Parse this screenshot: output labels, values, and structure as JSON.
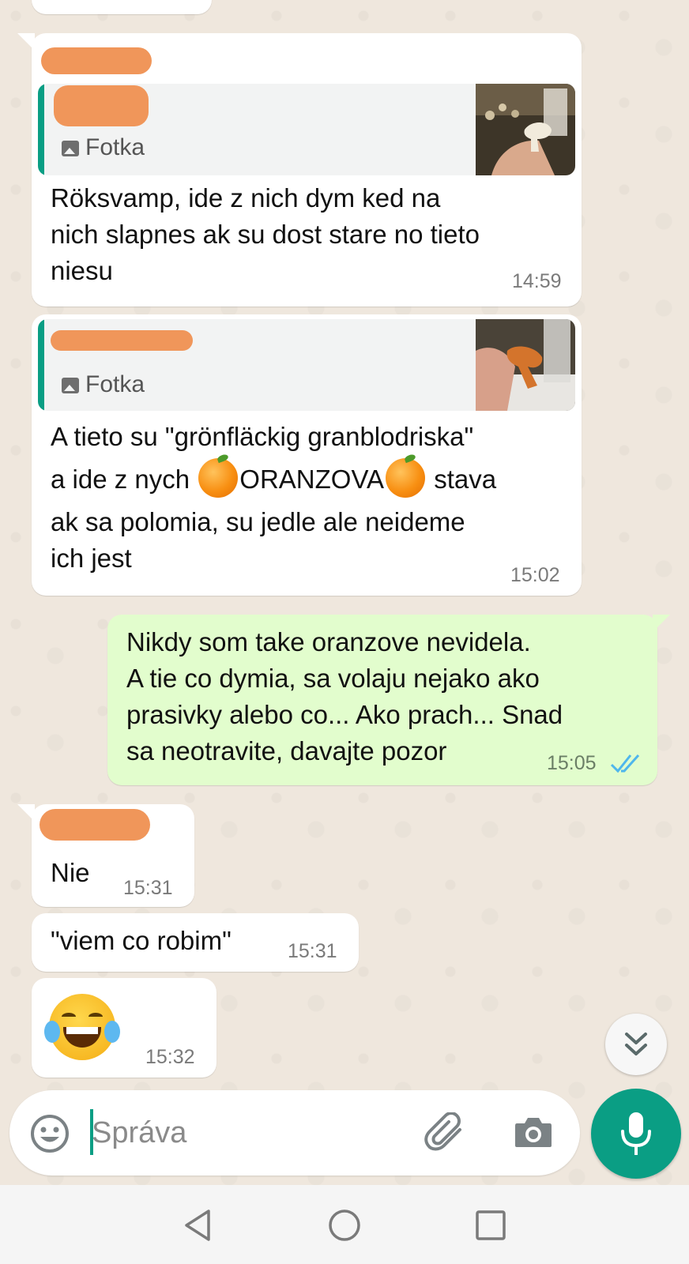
{
  "messages": [
    {
      "quote_label": "Fotka",
      "text_lines": [
        "Röksvamp, ide z nich dym ked na",
        "nich slapnes ak su dost stare no tieto",
        "niesu"
      ],
      "time": "14:59"
    },
    {
      "quote_label": "Fotka",
      "line1": "A tieto su \"grönfläckig granblodriska\"",
      "line2_a": "a ide z nych ",
      "line2_b": "ORANZOVA",
      "line2_c": " stava",
      "line3": "ak sa polomia, su jedle ale neideme",
      "line4": "ich jest",
      "time": "15:02"
    },
    {
      "text_lines": [
        "Nikdy som take oranzove nevidela.",
        "A tie co dymia, sa volaju nejako ako",
        "prasivky alebo co... Ako prach... Snad",
        "sa neotravite, davajte pozor"
      ],
      "time": "15:05"
    },
    {
      "text": "Nie",
      "time": "15:31"
    },
    {
      "text": "\"viem co robim\"",
      "time": "15:31"
    },
    {
      "emoji": "face-with-tears-of-joy",
      "time": "15:32"
    }
  ],
  "input": {
    "placeholder": "Správa"
  },
  "icons": {
    "emoji": "smiley-icon",
    "attach": "paperclip-icon",
    "camera": "camera-icon",
    "mic": "microphone-icon",
    "scroll": "double-chevron-down-icon",
    "read": "double-check-icon"
  },
  "colors": {
    "accent": "#0a9e84",
    "outgoing_bubble": "#e2fdcd",
    "incoming_bubble": "#ffffff",
    "read_receipt": "#4fb6ec"
  }
}
